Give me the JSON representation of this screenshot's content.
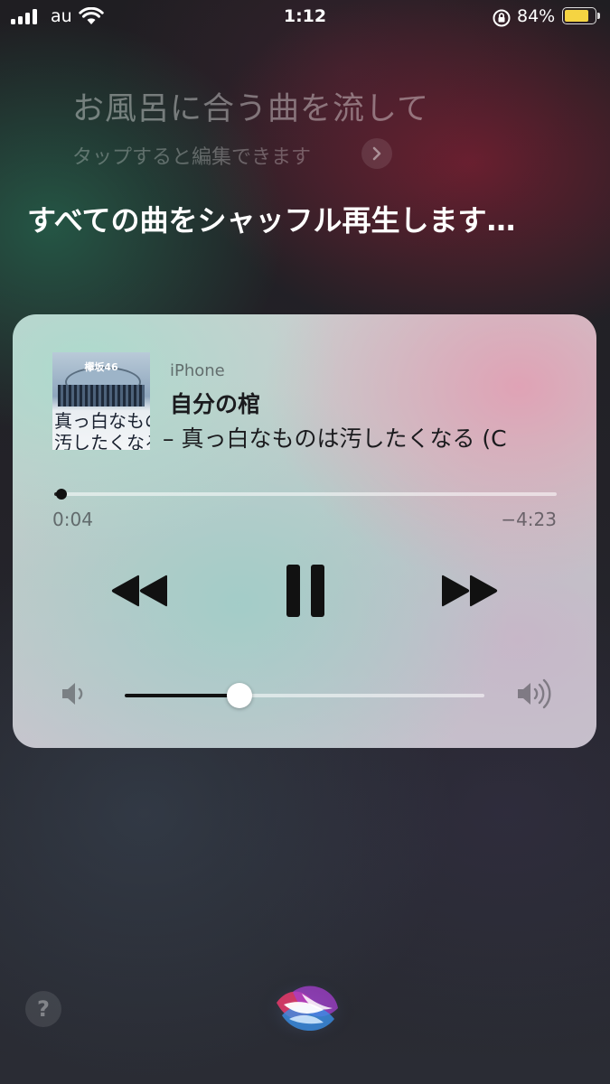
{
  "status_bar": {
    "carrier": "au",
    "time": "1:12",
    "battery_percent": "84%",
    "battery_level": 0.84,
    "icons": [
      "signal-icon",
      "wifi-icon",
      "rotation-lock-icon",
      "battery-icon"
    ]
  },
  "siri": {
    "query": "お風呂に合う曲を流して",
    "edit_hint": "タップすると編集できます",
    "response": "すべての曲をシャッフル再生します…",
    "help_label": "?"
  },
  "now_playing": {
    "album_art_text": {
      "band": "欅坂46",
      "line1": "真っ白なものは",
      "line2": "汚したくなる"
    },
    "source": "iPhone",
    "title": "自分の棺",
    "subtitle": "– 真っ白なものは汚したくなる (C",
    "elapsed": "0:04",
    "remaining": "−4:23",
    "progress": 0.015,
    "volume": 0.32
  },
  "colors": {
    "battery": "#f5d442",
    "controls": "#111111"
  }
}
